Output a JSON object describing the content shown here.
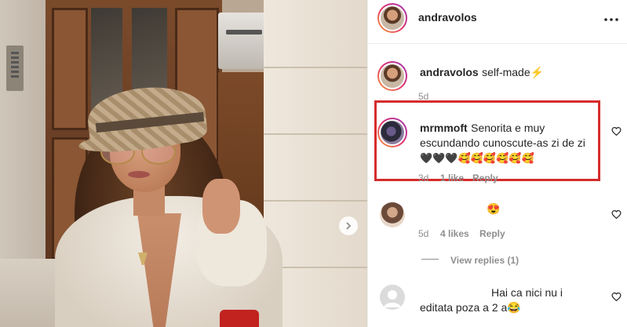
{
  "post": {
    "author": "andravolos",
    "caption_user": "andravolos",
    "caption_text": "self-made⚡",
    "caption_time": "5d"
  },
  "comments": [
    {
      "user": "mrmmoft",
      "line1": "Senorita e muy",
      "line2": "escundando cunoscute-as zi de zi",
      "line3": "🖤🖤🖤🥰🥰🥰🥰🥰🥰",
      "time": "3d",
      "likes": "1 like",
      "reply": "Reply",
      "highlighted": true
    },
    {
      "user": "",
      "text": "😍",
      "time": "5d",
      "likes": "4 likes",
      "reply": "Reply",
      "view_replies": "View replies (1)"
    },
    {
      "user": "",
      "line1": "Hai ca nici nu i",
      "line2": "editata poza a 2 a😂"
    }
  ],
  "icons": {
    "more": "more-options-icon",
    "heart": "heart-outline-icon",
    "next": "chevron-right-icon"
  },
  "colors": {
    "highlight_border": "#d62c2c",
    "secondary_text": "#8e8e8e",
    "primary_text": "#262626"
  }
}
